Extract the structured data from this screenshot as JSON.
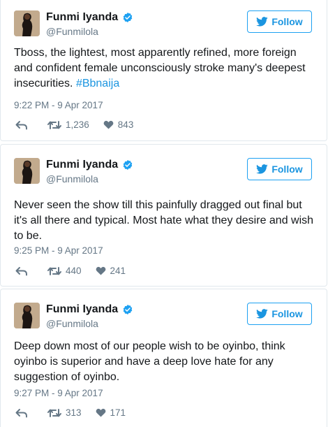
{
  "tweets": [
    {
      "name": "Funmi Iyanda",
      "handle": "@Funmilola",
      "follow_label": "Follow",
      "text": "Tboss, the lightest, most apparently refined, more foreign and confident female unconsciously stroke many's deepest insecurities.",
      "hashtag": "#Bbnaija",
      "timestamp": "9:22 PM - 9 Apr 2017",
      "retweets": "1,236",
      "likes": "843"
    },
    {
      "name": "Funmi Iyanda",
      "handle": "@Funmilola",
      "follow_label": "Follow",
      "text": "Never seen the show till this painfully dragged out final but it's all there and typical. Most hate what they desire and wish to be.",
      "hashtag": "",
      "timestamp": "9:25 PM - 9 Apr 2017",
      "retweets": "440",
      "likes": "241"
    },
    {
      "name": "Funmi Iyanda",
      "handle": "@Funmilola",
      "follow_label": "Follow",
      "text": "Deep down most of our people wish to be oyinbo, think oyinbo is superior and have a deep love hate for any suggestion of oyinbo.",
      "hashtag": "",
      "timestamp": "9:27 PM - 9 Apr 2017",
      "retweets": "313",
      "likes": "171"
    }
  ],
  "colors": {
    "link": "#1b95e0",
    "verified": "#1da1f2",
    "meta": "#657786",
    "border": "#e1e8ed"
  },
  "icons": [
    "verified-badge-icon",
    "twitter-bird-icon",
    "reply-icon",
    "retweet-icon",
    "heart-icon"
  ]
}
